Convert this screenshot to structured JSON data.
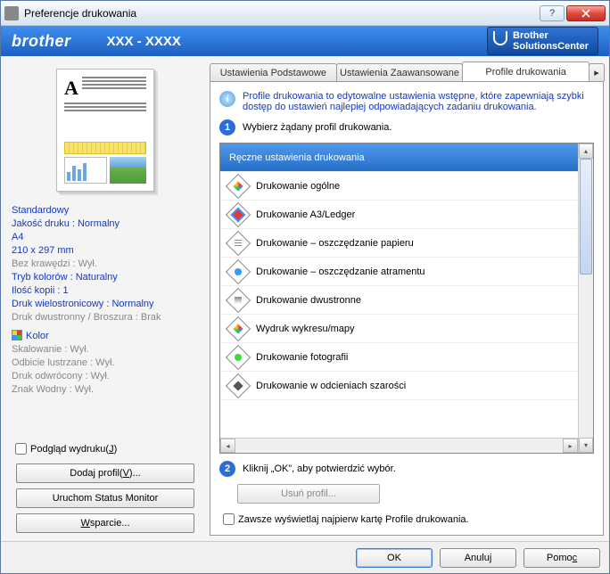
{
  "titlebar": {
    "title": "Preferencje drukowania"
  },
  "brand": {
    "logo": "brother",
    "model": "XXX - XXXX",
    "sc_line1": "Brother",
    "sc_line2": "SolutionsCenter"
  },
  "settings": {
    "s1": "Standardowy",
    "s2": "Jakość druku : Normalny",
    "s3": "A4",
    "s4": "210 x 297 mm",
    "s5": "Bez krawędzi : Wył.",
    "s6": "Tryb kolorów : Naturalny",
    "s7": "Ilość kopii : 1",
    "s8": "Druk wielostronicowy  : Normalny",
    "s9": "Druk dwustronny / Broszura : Brak",
    "s10": "Kolor",
    "s11": "Skalowanie : Wył.",
    "s12": "Odbicie lustrzane  : Wył.",
    "s13": "Druk odwrócony  : Wył.",
    "s14": "Znak Wodny : Wył."
  },
  "left": {
    "preview_chk": "Podgląd wydruku(J)",
    "btn_add": "Dodaj profil(V)...",
    "btn_status": "Uruchom Status Monitor",
    "btn_support": "Wsparcie..."
  },
  "tabs": {
    "t1": "Ustawienia Podstawowe",
    "t2": "Ustawienia Zaawansowane",
    "t3": "Profile drukowania"
  },
  "panel": {
    "info": "Profile drukowania to edytowalne ustawienia wstępne, które zapewniają szybki dostęp do ustawień najlepiej odpowiadających zadaniu drukowania.",
    "step1": "Wybierz żądany profil drukowania.",
    "step2": "Kliknij „OK”, aby potwierdzić wybór.",
    "delete_btn": "Usuń profil...",
    "always_chk": "Zawsze wyświetlaj najpierw kartę Profile drukowania."
  },
  "profiles": {
    "p0": "Ręczne ustawienia drukowania",
    "p1": "Drukowanie ogólne",
    "p2": "Drukowanie A3/Ledger",
    "p3": "Drukowanie – oszczędzanie papieru",
    "p4": "Drukowanie – oszczędzanie atramentu",
    "p5": "Drukowanie dwustronne",
    "p6": "Wydruk wykresu/mapy",
    "p7": "Drukowanie fotografii",
    "p8": "Drukowanie w odcieniach szarości"
  },
  "buttons": {
    "ok": "OK",
    "cancel": "Anuluj",
    "help": "Pomoc"
  }
}
